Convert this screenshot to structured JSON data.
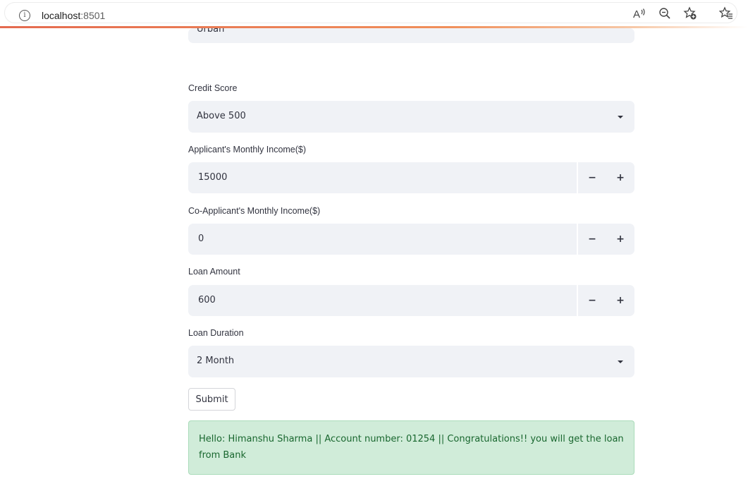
{
  "browser": {
    "url_host": "localhost",
    "url_port": ":8501",
    "icons": [
      "info-icon",
      "read-aloud-icon",
      "zoom-out-icon",
      "add-favorite-icon",
      "favorites-icon"
    ]
  },
  "form": {
    "area_partial_value": "Urban",
    "credit_score": {
      "label": "Credit Score",
      "value": "Above 500"
    },
    "applicant_income": {
      "label": "Applicant's Monthly Income($)",
      "value": "15000",
      "minus": "−",
      "plus": "+"
    },
    "coapplicant_income": {
      "label": "Co-Applicant's Monthly Income($)",
      "value": "0",
      "minus": "−",
      "plus": "+"
    },
    "loan_amount": {
      "label": "Loan Amount",
      "value": "600",
      "minus": "−",
      "plus": "+"
    },
    "loan_duration": {
      "label": "Loan Duration",
      "value": "2 Month"
    },
    "submit_label": "Submit"
  },
  "result": {
    "message": "Hello: Himanshu Sharma || Account number: 01254 || Congratulations!! you will get the loan from Bank"
  },
  "colors": {
    "field_bg": "#f0f2f6",
    "success_bg": "#d0ecd9",
    "success_text": "#19672f",
    "progress_accent": "#e46a4f"
  }
}
